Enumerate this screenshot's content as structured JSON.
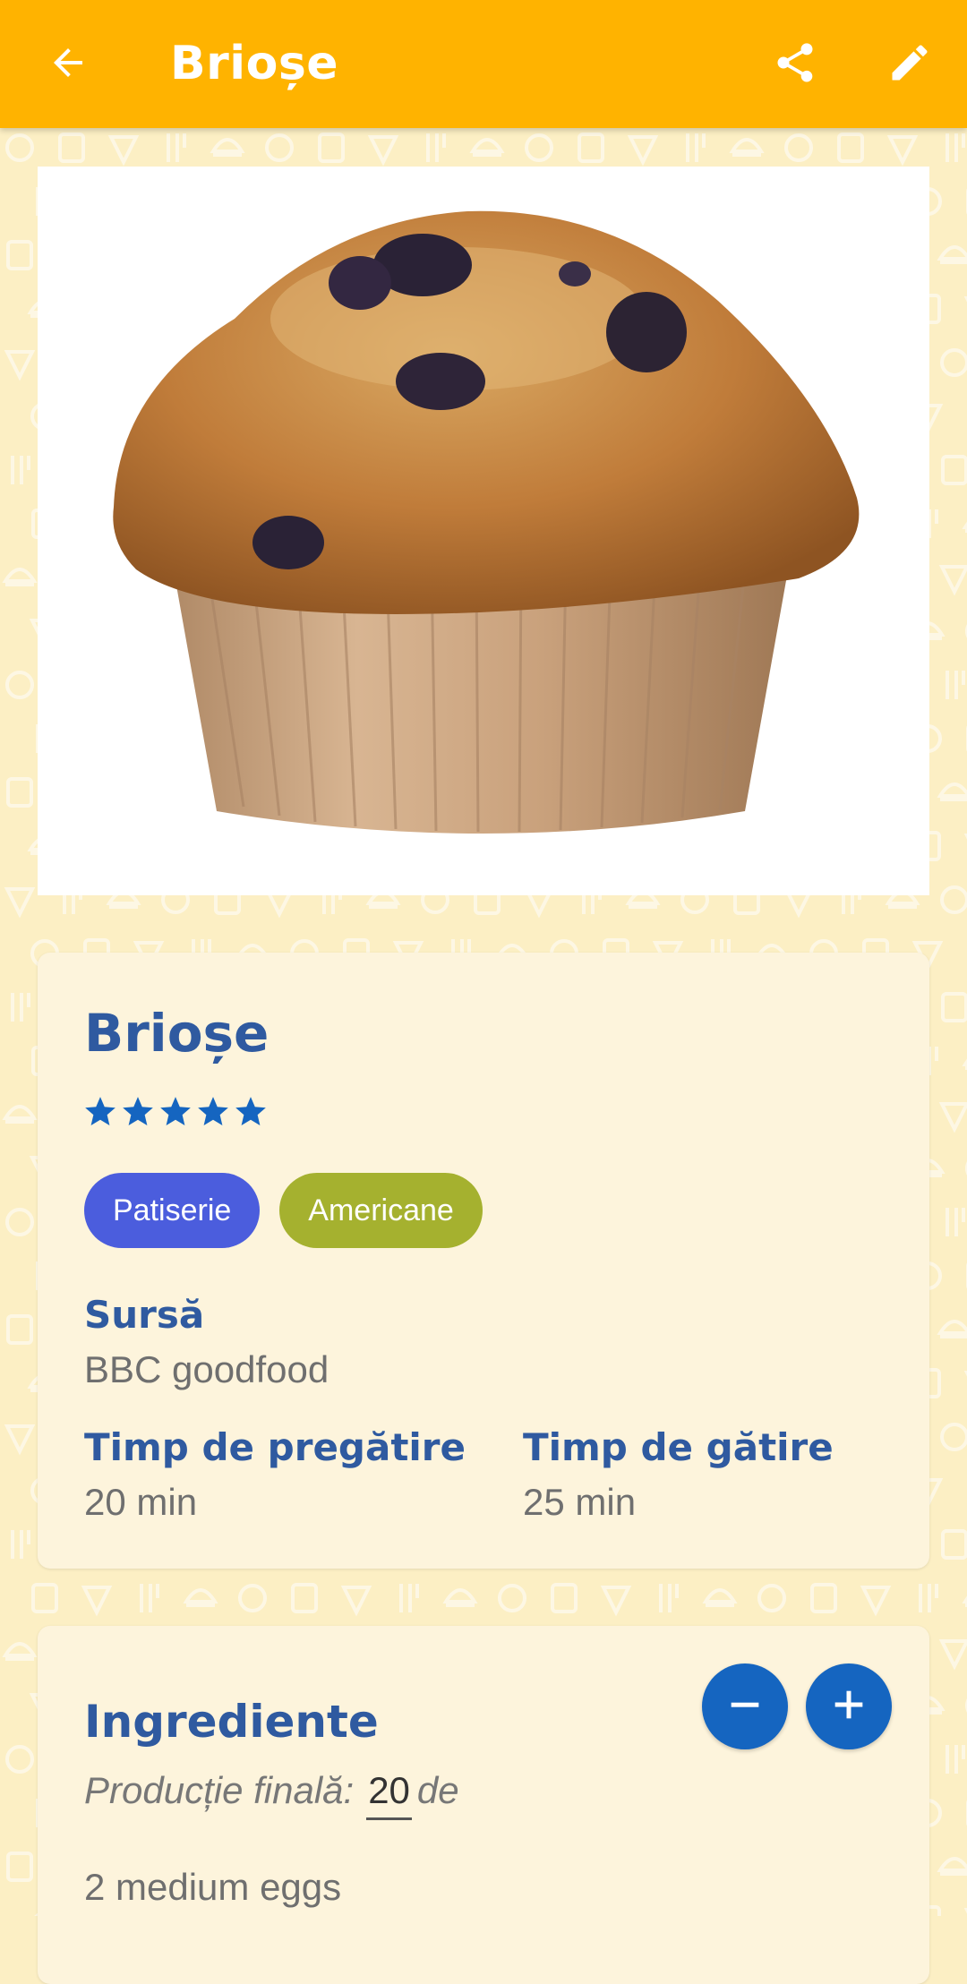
{
  "app_bar": {
    "title": "Brioșe",
    "back_icon": "arrow-back-icon",
    "share_icon": "share-icon",
    "edit_icon": "edit-pencil-icon",
    "background_color": "#ffb300"
  },
  "recipe": {
    "image_subject": "blueberry-muffin",
    "title": "Brioșe",
    "rating": 5,
    "rating_max": 5,
    "tags": [
      {
        "label": "Patiserie",
        "color": "#4b5ddd"
      },
      {
        "label": "Americane",
        "color": "#a5b12f"
      }
    ],
    "source": {
      "label": "Sursă",
      "value": "BBC goodfood"
    },
    "prep_time": {
      "label": "Timp de pregătire",
      "value": "20 min"
    },
    "cook_time": {
      "label": "Timp de gătire",
      "value": "25 min"
    }
  },
  "ingredients": {
    "title": "Ingrediente",
    "minus_icon": "minus-icon",
    "plus_icon": "plus-icon",
    "yield_label": "Producție finală:",
    "yield_value": "20",
    "yield_suffix": "de",
    "items": [
      "2 medium eggs"
    ]
  },
  "colors": {
    "accent_blue": "#1565c0",
    "heading_blue": "#2f5aa0",
    "page_background": "#fcefc4",
    "card_background": "#fdf4dc"
  }
}
